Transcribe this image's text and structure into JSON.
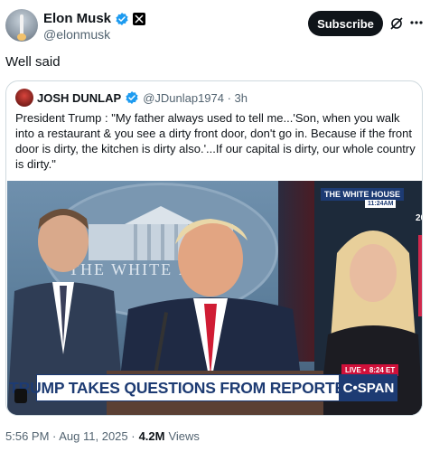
{
  "post": {
    "display_name": "Elon Musk",
    "handle": "@elonmusk",
    "subscribe_label": "Subscribe",
    "text": "Well said"
  },
  "quote": {
    "name": "JOSH DUNLAP",
    "handle_time": "@JDunlap1974 · 3h",
    "text": "President Trump : \"My father always used to tell me...'Son, when you walk into a restaurant & you see a dirty front door, don't go in. Because if the front door is dirty, the kitchen is dirty also.'...If our capital is dirty, our whole country is dirty.\""
  },
  "video": {
    "seal_text": "THE WHITE H",
    "wh_label": "THE WHITE HOUSE",
    "wh_time": "11:24AM",
    "edge_number": "20",
    "live_label": "LIVE •",
    "live_time": "8:24 ET",
    "banner": "TRUMP TAKES QUESTIONS FROM REPORTERS",
    "network": "C•SPAN"
  },
  "footer": {
    "timestamp": "5:56 PM · Aug 11, 2025 ·",
    "views_count": "4.2M",
    "views_label": "Views"
  },
  "colors": {
    "verified": "#1d9bf0",
    "banner_blue": "#1d3b73",
    "live_red": "#d0103a"
  }
}
